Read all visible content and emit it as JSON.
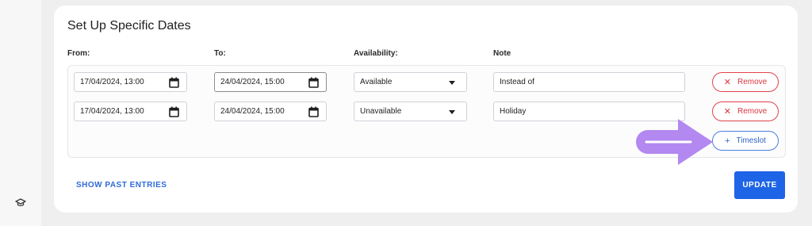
{
  "section": {
    "title": "Set Up Specific Dates"
  },
  "columns": {
    "from": "From:",
    "to": "To:",
    "availability": "Availability:",
    "note": "Note"
  },
  "rows": [
    {
      "from": "17/04/2024, 13:00",
      "to": "24/04/2024, 15:00",
      "availability": "Available",
      "note": "Instead of",
      "remove_label": "Remove"
    },
    {
      "from": "17/04/2024, 13:00",
      "to": "24/04/2024, 15:00",
      "availability": "Unavailable",
      "note": "Holiday",
      "remove_label": "Remove"
    }
  ],
  "actions": {
    "add_timeslot_label": "Timeslot",
    "show_past_label": "SHOW PAST ENTRIES",
    "update_label": "UPDATE"
  },
  "icons": {
    "rail": "graduation-cap-icon",
    "date_picker": "calendar-icon",
    "dropdown": "caret-down-icon",
    "remove": "close-icon",
    "add": "plus-icon",
    "annotation": "arrow-right-icon"
  },
  "colors": {
    "accent": "#1e64e6",
    "danger": "#e0444b",
    "annotation_arrow": "#b388f0"
  }
}
